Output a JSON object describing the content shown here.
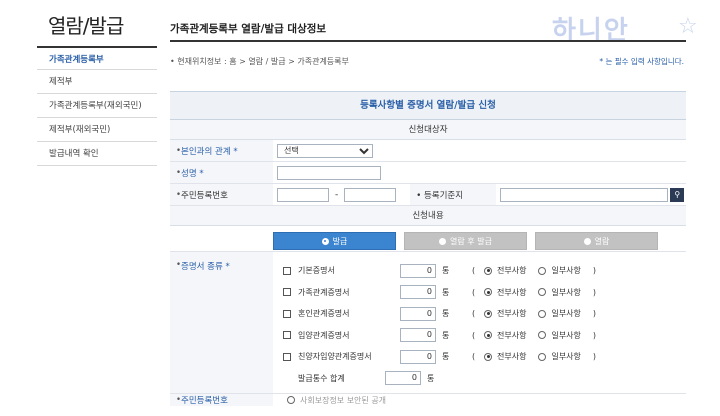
{
  "sidebar": {
    "title": "열람/발급",
    "items": [
      {
        "label": "가족관계등록부",
        "active": true
      },
      {
        "label": "제적부",
        "active": false
      },
      {
        "label": "가족관계등록부(재외국민)",
        "active": false
      },
      {
        "label": "제적부(재외국민)",
        "active": false
      },
      {
        "label": "발급내역 확인",
        "active": false
      }
    ]
  },
  "header": {
    "title": "가족관계등록부 열람/발급 대상정보",
    "breadcrumb": "• 현재위치정보 : 홈 > 열람 / 발급 > 가족관계등록부",
    "required_note": "* 는 필수 입력 사항입니다.",
    "watermark": "하니안",
    "watermark_star": "☆"
  },
  "form": {
    "title": "등록사항별 증명서 열람/발급 신청",
    "section_target": "신청대상자",
    "relation_label": "본인과의 관계 *",
    "relation_value": "선택",
    "name_label": "성명 *",
    "rrn_label": "주민등록번호",
    "rrn_dash": "-",
    "base_label": "• 등록기준지",
    "section_content": "신청내용",
    "tabs": [
      {
        "label": "발급",
        "active": true
      },
      {
        "label": "열람 후 발급",
        "active": false
      },
      {
        "label": "열람",
        "active": false
      }
    ],
    "cert_label": "증명서 종류 *",
    "certs": [
      {
        "name": "기본증명서",
        "count": "0",
        "unit": "통",
        "open": "(",
        "full": "전부사항",
        "partial": "일부사항",
        "close": ")"
      },
      {
        "name": "가족관계증명서",
        "count": "0",
        "unit": "통",
        "open": "(",
        "full": "전부사항",
        "partial": "일부사항",
        "close": ")"
      },
      {
        "name": "혼인관계증명서",
        "count": "0",
        "unit": "통",
        "open": "(",
        "full": "전부사항",
        "partial": "일부사항",
        "close": ")"
      },
      {
        "name": "입양관계증명서",
        "count": "0",
        "unit": "통",
        "open": "(",
        "full": "전부사항",
        "partial": "일부사항",
        "close": ")"
      },
      {
        "name": "친양자입양관계증명서",
        "count": "0",
        "unit": "통",
        "open": "(",
        "full": "전부사항",
        "partial": "일부사항",
        "close": ")"
      }
    ],
    "total_label": "발급통수 합계",
    "total_count": "0",
    "total_unit": "통",
    "next_label": "주민등록번호",
    "next_value": "사회보장정보 보안된 공개"
  },
  "colors": {
    "accent": "#2a5fa8",
    "tab_active": "#3b84cf",
    "tab_inactive": "#c2c2c2",
    "label_bg": "#f4f6f9"
  }
}
